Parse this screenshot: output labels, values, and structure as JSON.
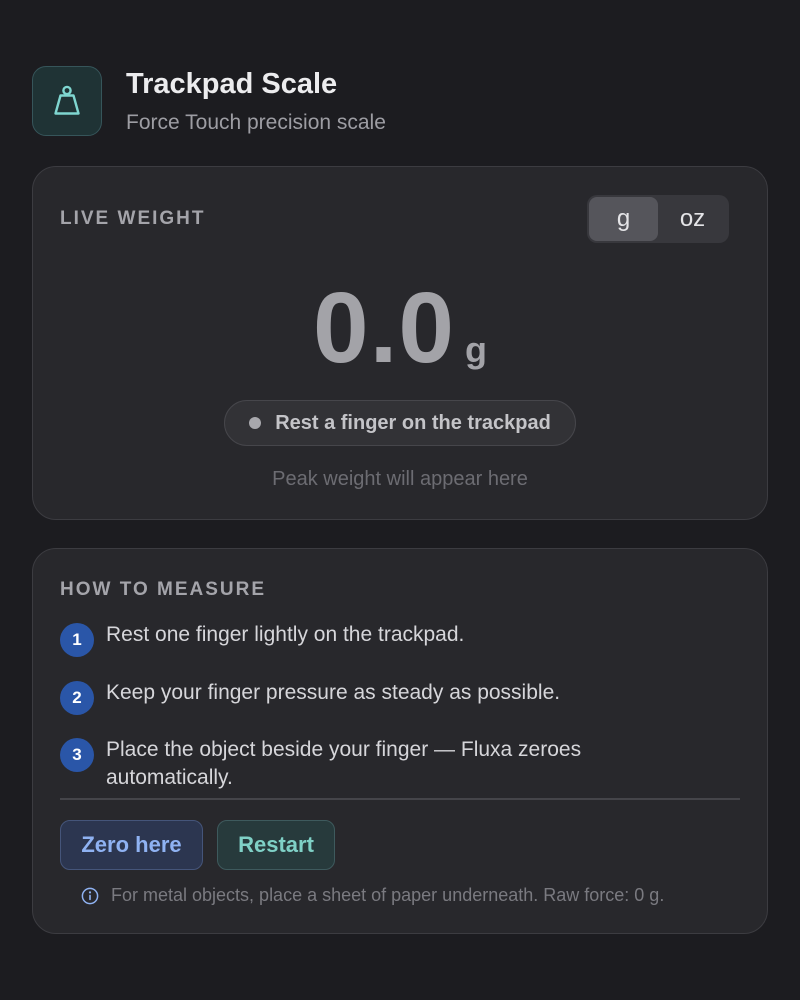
{
  "app": {
    "title": "Trackpad Scale",
    "subtitle": "Force Touch precision scale",
    "icon": "weight-icon",
    "accent": "#7fd0c6"
  },
  "live": {
    "label": "LIVE WEIGHT",
    "units": [
      "g",
      "oz"
    ],
    "selected_unit": "g",
    "value": "0.0",
    "unit": "g",
    "status": "Rest a finger on the trackpad",
    "peak": "Peak weight will appear here"
  },
  "how": {
    "label": "HOW TO MEASURE",
    "steps": [
      {
        "num": "1",
        "text": "Rest one finger lightly on the trackpad."
      },
      {
        "num": "2",
        "text": "Keep your finger pressure as steady as possible."
      },
      {
        "num": "3",
        "text": "Place the object beside your finger — Fluxa zeroes automatically."
      }
    ],
    "zero_label": "Zero here",
    "restart_label": "Restart",
    "hint_icon": "info-icon",
    "hint": "For metal objects, place a sheet of paper underneath. Raw force: 0 g."
  }
}
